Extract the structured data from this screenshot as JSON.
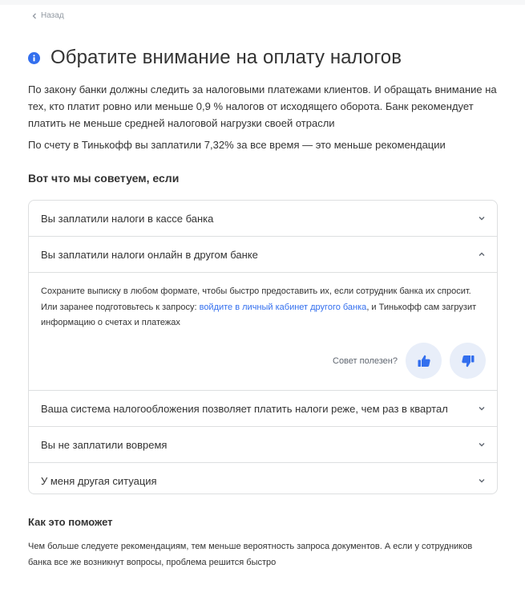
{
  "nav": {
    "back_label": "Назад"
  },
  "header": {
    "title": "Обратите внимание на оплату налогов"
  },
  "intro": {
    "paragraph1": "По закону банки должны следить за налоговыми платежами клиентов. И обращать внимание на тех, кто платит ровно или меньше 0,9 % налогов от исходящего оборота. Банк рекомендует платить не меньше средней налоговой нагрузки своей отрасли",
    "paragraph2": "По счету в Тинькофф вы заплатили 7,32% за все время — это меньше рекомендации"
  },
  "advice": {
    "title": "Вот что мы советуем, если",
    "items": [
      {
        "label": "Вы заплатили налоги в кассе банка",
        "expanded": false
      },
      {
        "label": "Вы заплатили налоги онлайн в другом банке",
        "expanded": true
      },
      {
        "label": "Ваша система налогообложения позволяет платить налоги реже, чем раз в квартал",
        "expanded": false
      },
      {
        "label": "Вы не заплатили вовремя",
        "expanded": false
      },
      {
        "label": "У меня другая ситуация",
        "expanded": false
      }
    ],
    "expanded_body": {
      "text_before": "Сохраните выписку в любом формате, чтобы быстро предоставить их, если сотрудник банка их спросит. Или заранее подготовьтесь к запросу: ",
      "link": "войдите в личный кабинет другого банка",
      "text_after": ", и Тинькофф сам загрузит информацию о счетах и платежах",
      "feedback_label": "Совет полезен?"
    }
  },
  "help": {
    "title": "Как это поможет",
    "text": "Чем больше следуете рекомендациям, тем меньше вероятность запроса документов. А если у сотрудников банка все же возникнут вопросы, проблема решится быстро"
  },
  "colors": {
    "accent": "#336fee",
    "button_bg": "#e8eef9",
    "border": "#dddfe0",
    "muted": "#9299a2"
  },
  "icons": {
    "back": "chevron-left-icon",
    "info": "info-icon",
    "collapse": "chevron-up-icon",
    "expand": "chevron-down-icon",
    "like": "thumbs-up-icon",
    "dislike": "thumbs-down-icon"
  }
}
